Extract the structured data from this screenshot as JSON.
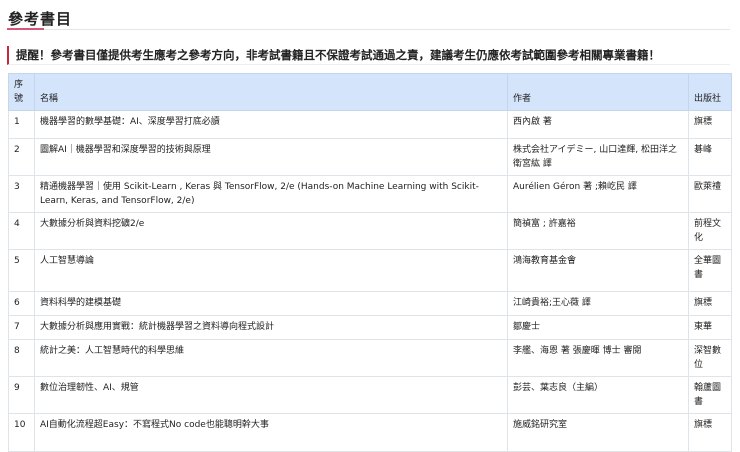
{
  "title": "參考書目",
  "notice": "提醒！參考書目僅提供考生應考之參考方向，非考試書籍且不保證考試通過之責，建議考生仍應依考試範圍參考相關專業書籍！",
  "table": {
    "headers": {
      "no": "序號",
      "name": "名稱",
      "author": "作者",
      "publisher": "出版社"
    },
    "rows": [
      {
        "no": "1",
        "name": "機器學習的數學基礎：AI、深度學習打底必讀",
        "author": "西內啟 著",
        "publisher": "旗標"
      },
      {
        "no": "2",
        "name": "圖解AI｜機器學習和深度學習的技術與原理",
        "author": "株式会社アイデミー, 山口達輝, 松田洋之 衛宮紘 譯",
        "publisher": "碁峰"
      },
      {
        "no": "3",
        "name": "精通機器學習｜使用 Scikit-Learn , Keras 與 TensorFlow, 2/e (Hands-on Machine Learning with Scikit-Learn, Keras, and TensorFlow, 2/e)",
        "author": "Aurélien Géron 著 ;賴屹民 譯",
        "publisher": "歐萊禮"
      },
      {
        "no": "4",
        "name": "大數據分析與資料挖礦2/e",
        "author": "簡禎富 ; 許嘉裕",
        "publisher": "前程文化"
      },
      {
        "no": "5",
        "name": "人工智慧導論",
        "author": "鴻海教育基金會",
        "publisher": "全華圖書"
      },
      {
        "no": "6",
        "name": "資料科學的建模基礎",
        "author": "江崎貴裕;王心薇 譯",
        "publisher": "旗標"
      },
      {
        "no": "7",
        "name": "大數據分析與應用實戰：統計機器學習之資料導向程式設計",
        "author": "鄒慶士",
        "publisher": "東華"
      },
      {
        "no": "8",
        "name": "統計之美：人工智慧時代的科學思維",
        "author": "李艦、海恩 著 張慶暉 博士 審閱",
        "publisher": "深智數位"
      },
      {
        "no": "9",
        "name": "數位治理韌性、AI、規管",
        "author": "彭芸、葉志良（主編）",
        "publisher": "翰蘆圖書"
      },
      {
        "no": "10",
        "name": "AI自動化流程超Easy：不寫程式No code也能聰明幹大事",
        "author": "施威銘研究室",
        "publisher": "旗標"
      }
    ]
  }
}
